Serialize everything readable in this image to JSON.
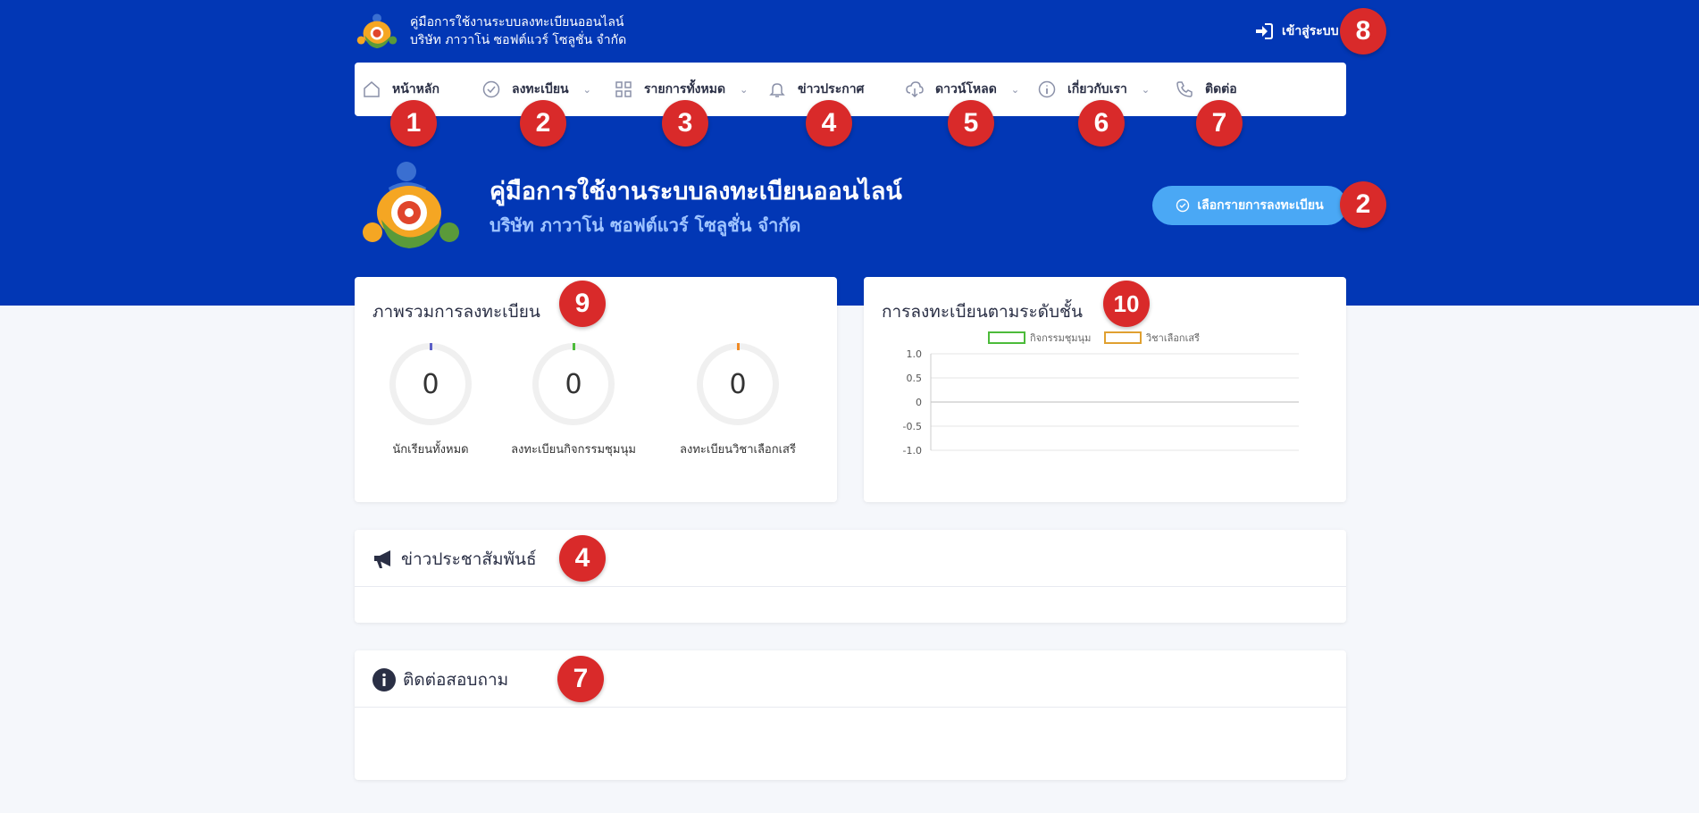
{
  "brand": {
    "line1": "คู่มือการใช้งานระบบลงทะเบียนออนไลน์",
    "line2": "บริษัท ภาวาโน่ ซอฟต์แวร์ โซลูชั่น จำกัด"
  },
  "login_label": "เข้าสู่ระบบ",
  "nav": {
    "home": "หน้าหลัก",
    "register": "ลงทะเบียน",
    "all_items": "รายการทั้งหมด",
    "news": "ข่าวประกาศ",
    "download": "ดาวน์โหลด",
    "about": "เกี่ยวกับเรา",
    "contact": "ติดต่อ"
  },
  "hero": {
    "title": "คู่มือการใช้งานระบบลงทะเบียนออนไลน์",
    "subtitle": "บริษัท ภาวาโน่ ซอฟต์แวร์ โซลูชั่น จำกัด",
    "button_label": "เลือกรายการลงทะเบียน"
  },
  "badges": [
    "1",
    "2",
    "3",
    "4",
    "5",
    "6",
    "7",
    "8",
    "2",
    "9",
    "10",
    "4",
    "7"
  ],
  "overview": {
    "title": "ภาพรวมการลงทะเบียน",
    "stats": [
      {
        "value": "0",
        "label": "นักเรียนทั้งหมด",
        "color": "#5b5fc7"
      },
      {
        "value": "0",
        "label": "ลงทะเบียนกิจกรรมชุมนุม",
        "color": "#4cbb3a"
      },
      {
        "value": "0",
        "label": "ลงทะเบียนวิชาเลือกเสรี",
        "color": "#f08a24"
      }
    ]
  },
  "level_chart": {
    "title": "การลงทะเบียนตามระดับชั้น"
  },
  "chart_data": {
    "type": "bar",
    "categories": [],
    "series": [
      {
        "name": "กิจกรรมชุมนุม",
        "values": [],
        "color": "#4cbb3a"
      },
      {
        "name": "วิชาเลือกเสรี",
        "values": [],
        "color": "#e0a030"
      }
    ],
    "yticks": [
      "1.0",
      "0.5",
      "0",
      "-0.5",
      "-1.0"
    ],
    "ylim": [
      -1,
      1
    ],
    "grid": true,
    "legend": "top"
  },
  "news_section": {
    "title": "ข่าวประชาสัมพันธ์"
  },
  "contact_section": {
    "title": "ติดต่อสอบถาม"
  }
}
